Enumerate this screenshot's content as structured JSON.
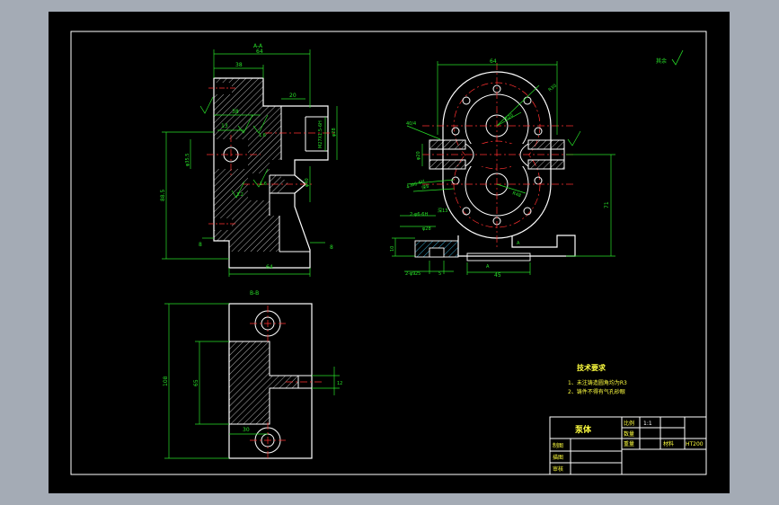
{
  "sections": {
    "aa_label": "A-A",
    "bb_label": "B-B",
    "a_marker": "A"
  },
  "roughness_note": "其余",
  "dims_left": {
    "top_overall": "64",
    "top_part": "38",
    "hole_depth": "38",
    "groove": "20",
    "small_20": "20",
    "left_13": "13",
    "dia_35": "φ35.5",
    "thread": "M27X1.5-6H",
    "dia_28": "φ28",
    "dia_40": "φ40",
    "height_88": "88.5",
    "dia_20": "φ20",
    "bottom_8": "8",
    "bottom_64": "64",
    "right_8": "8",
    "d1": "1.6",
    "d2": "3.2",
    "d3": "1.6"
  },
  "dims_right": {
    "top_64": "64",
    "r20": "R20",
    "r30": "R30",
    "r48": "R48",
    "c40": "40/4",
    "holes": "4-M6-6H",
    "holes_depth": "深8",
    "phi13": "2-φ6-6H",
    "depth_13": "深13",
    "dia_28": "φ28",
    "dia_20": "φ20",
    "dim_71": "71",
    "dim_10": "10",
    "dim_45": "45",
    "bot_2": "2-φ9",
    "bot_25": "25",
    "bot_5": "5",
    "a_low": "A"
  },
  "dims_bottom": {
    "height_108": "108",
    "dim_65": "65",
    "dim_32": "32",
    "dim_30": "30",
    "dim_12": "12"
  },
  "notes": {
    "title": "技术要求",
    "items": [
      "1、未注铸造圆角均为R3",
      "2、铸件不得有气孔砂眼"
    ]
  },
  "title_block": {
    "part_name": "泵体",
    "scale_label": "比例",
    "scale_value": "1:1",
    "quantity_label": "数量",
    "weight_label": "重量",
    "material_label": "材料",
    "material_value": "HT200",
    "drawn_label": "制图",
    "checked_label": "描图",
    "reviewed_label": "审核"
  }
}
